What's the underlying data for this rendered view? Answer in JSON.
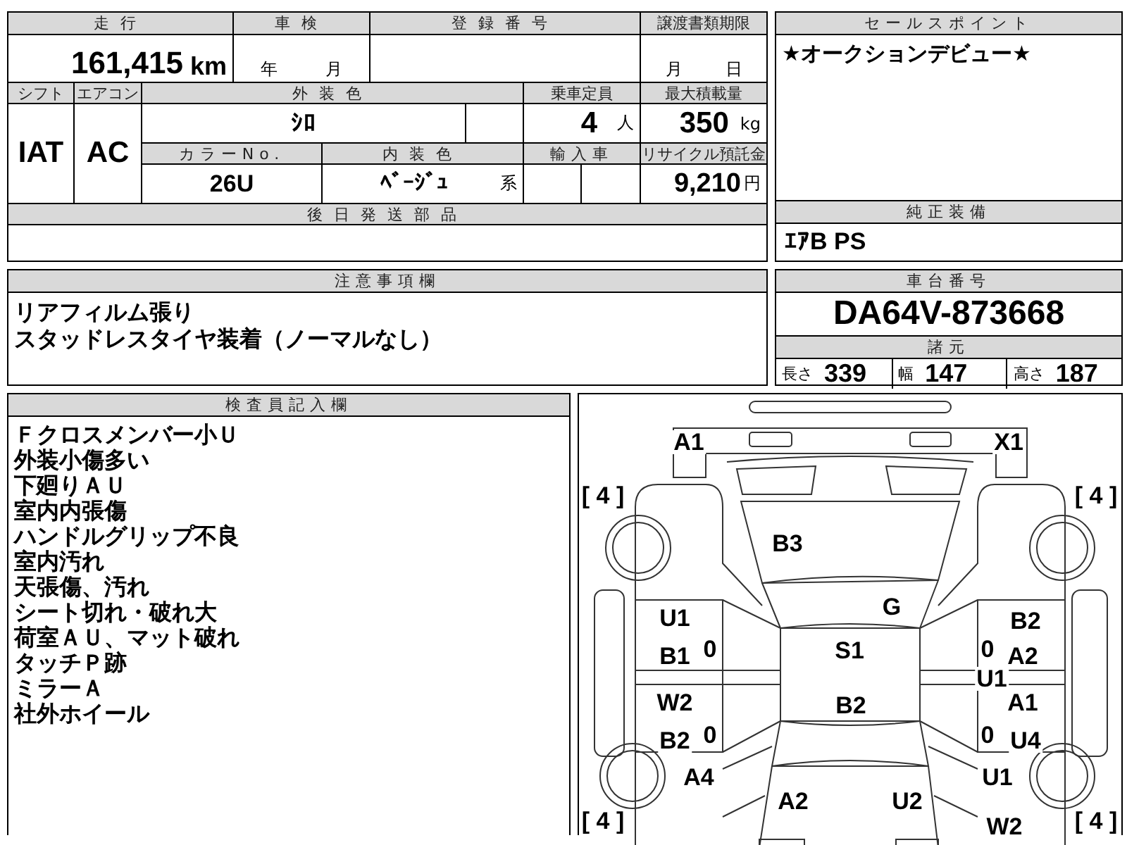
{
  "mileage": {
    "label": "走行",
    "value": "161,415",
    "unit": "km"
  },
  "inspection": {
    "label": "車検",
    "year_unit": "年",
    "month_unit": "月"
  },
  "registration": {
    "label": "登録番号"
  },
  "transfer_deadline": {
    "label": "譲渡書類期限",
    "month_unit": "月",
    "day_unit": "日"
  },
  "shift": {
    "label": "シフト",
    "value": "IAT"
  },
  "aircon": {
    "label": "エアコン",
    "value": "AC"
  },
  "exterior_color": {
    "label": "外装色",
    "value": "ｼﾛ"
  },
  "capacity": {
    "label": "乗車定員",
    "value": "4",
    "unit": "人"
  },
  "max_load": {
    "label": "最大積載量",
    "value": "350",
    "unit": "kg"
  },
  "color_no": {
    "label": "カラーNo.",
    "value": "26U"
  },
  "interior_color": {
    "label": "内装色",
    "value": "ﾍﾞｰｼﾞｭ",
    "suffix": "系"
  },
  "imported": {
    "label": "輸入車"
  },
  "recycle_fee": {
    "label": "リサイクル預託金",
    "value": "9,210",
    "unit": "円"
  },
  "later_parts": {
    "label": "後日発送部品"
  },
  "sales_point": {
    "label": "セールスポイント",
    "text": "★オークションデビュー★"
  },
  "standard_equipment": {
    "label": "純正装備",
    "value": "ｴｱB PS"
  },
  "notes": {
    "label": "注意事項欄",
    "lines": [
      "リアフィルム張り",
      "スタッドレスタイヤ装着（ノーマルなし）"
    ]
  },
  "chassis": {
    "label": "車台番号",
    "value": "DA64V-873668"
  },
  "specs": {
    "label": "諸元",
    "items": [
      {
        "label": "長さ",
        "value": "339"
      },
      {
        "label": "幅",
        "value": "147"
      },
      {
        "label": "高さ",
        "value": "187"
      }
    ]
  },
  "inspector_notes": {
    "label": "検査員記入欄",
    "lines": [
      "Ｆクロスメンバー小Ｕ",
      "外装小傷多い",
      "下廻りＡＵ",
      "室内内張傷",
      "ハンドルグリップ不良",
      "室内汚れ",
      "天張傷、汚れ",
      "シート切れ・破れ大",
      "荷室ＡＵ、マット破れ",
      "タッチＰ跡",
      "ミラーＡ",
      "社外ホイール"
    ]
  },
  "diagram": {
    "tread_depths": [
      "[ 4 ]",
      "[ 4 ]",
      "[ 4 ]",
      "[ 4 ]"
    ],
    "marks": [
      "A1",
      "X1",
      "B3",
      "G",
      "U1",
      "B1",
      "0",
      "S1",
      "B2",
      "0",
      "A2",
      "U1",
      "W2",
      "B2",
      "A1",
      "B2",
      "0",
      "0",
      "U4",
      "A4",
      "U1",
      "A2",
      "U2",
      "W2"
    ]
  }
}
